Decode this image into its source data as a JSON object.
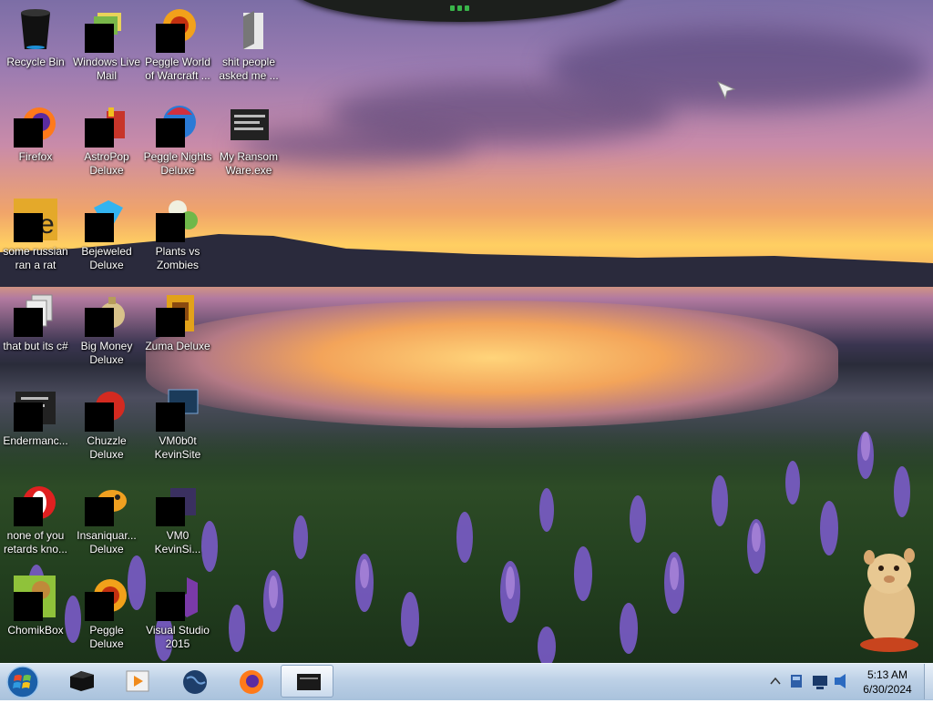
{
  "desktop": {
    "icons": [
      {
        "label": "Recycle Bin",
        "icon": "recycle-bin-icon"
      },
      {
        "label": "Windows Live Mail",
        "icon": "mail-icon"
      },
      {
        "label": "Peggle World of Warcraft ...",
        "icon": "peggle-icon"
      },
      {
        "label": "shit people asked me ...",
        "icon": "folder-icon"
      },
      {
        "label": "Firefox",
        "icon": "firefox-icon"
      },
      {
        "label": "AstroPop Deluxe",
        "icon": "astropop-icon"
      },
      {
        "label": "Peggle Nights Deluxe",
        "icon": "peggle-nights-icon"
      },
      {
        "label": "My Ransom Ware.exe",
        "icon": "console-icon"
      },
      {
        "label": "some russian ran a rat",
        "icon": "jar-file-icon"
      },
      {
        "label": "Bejeweled Deluxe",
        "icon": "bejeweled-icon"
      },
      {
        "label": "Plants vs Zombies",
        "icon": "plants-vs-zombies-icon"
      },
      {
        "label": "that but its c#",
        "icon": "files-icon"
      },
      {
        "label": "Big Money Deluxe",
        "icon": "money-bag-icon"
      },
      {
        "label": "Zuma Deluxe",
        "icon": "zuma-icon"
      },
      {
        "label": "Endermanc...",
        "icon": "console-icon"
      },
      {
        "label": "Chuzzle Deluxe",
        "icon": "chuzzle-icon"
      },
      {
        "label": "VM0b0t KevinSite",
        "icon": "monitor-icon"
      },
      {
        "label": "none of you retards kno...",
        "icon": "opera-icon"
      },
      {
        "label": "Insaniquar... Deluxe",
        "icon": "fish-icon"
      },
      {
        "label": "VM0 KevinSi...",
        "icon": "app-icon"
      },
      {
        "label": "ChomikBox",
        "icon": "chomikbox-icon"
      },
      {
        "label": "Peggle Deluxe",
        "icon": "peggle-icon"
      },
      {
        "label": "Visual Studio 2015",
        "icon": "visual-studio-icon"
      }
    ]
  },
  "taskbar": {
    "start_label": "Start",
    "pinned": [
      {
        "name": "Console",
        "icon": "console-icon"
      },
      {
        "name": "Media Player",
        "icon": "media-player-icon"
      },
      {
        "name": "Globe",
        "icon": "globe-icon"
      },
      {
        "name": "Firefox",
        "icon": "firefox-icon"
      },
      {
        "name": "Command Window",
        "icon": "window-icon",
        "active": true
      }
    ],
    "tray": {
      "icons": [
        "show-hidden-icons-chevron",
        "security-icon",
        "network-icon",
        "volume-icon"
      ]
    },
    "clock": {
      "time": "5:13 AM",
      "date": "6/30/2024"
    }
  },
  "colors": {
    "taskbar": "#bcd0e6",
    "censor": "#000000",
    "gadget_led": "#39b54a"
  }
}
